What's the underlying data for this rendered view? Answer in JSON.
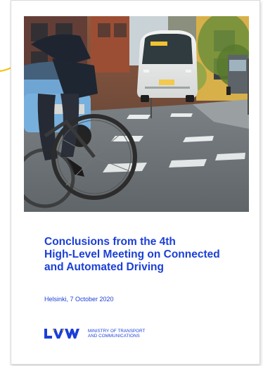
{
  "document": {
    "title_lines": [
      "Conclusions from the 4th",
      "High-Level Meeting on Connected",
      "and Automated Driving"
    ],
    "date_line": "Helsinki, 7 October 2020",
    "org_name_lines": [
      "MINISTRY OF TRANSPORT",
      "AND COMMUNICATIONS"
    ],
    "logo_letters": "LVM"
  },
  "colors": {
    "accent_blue": "#1b3fd6",
    "highlight_yellow": "#f4c20d"
  }
}
